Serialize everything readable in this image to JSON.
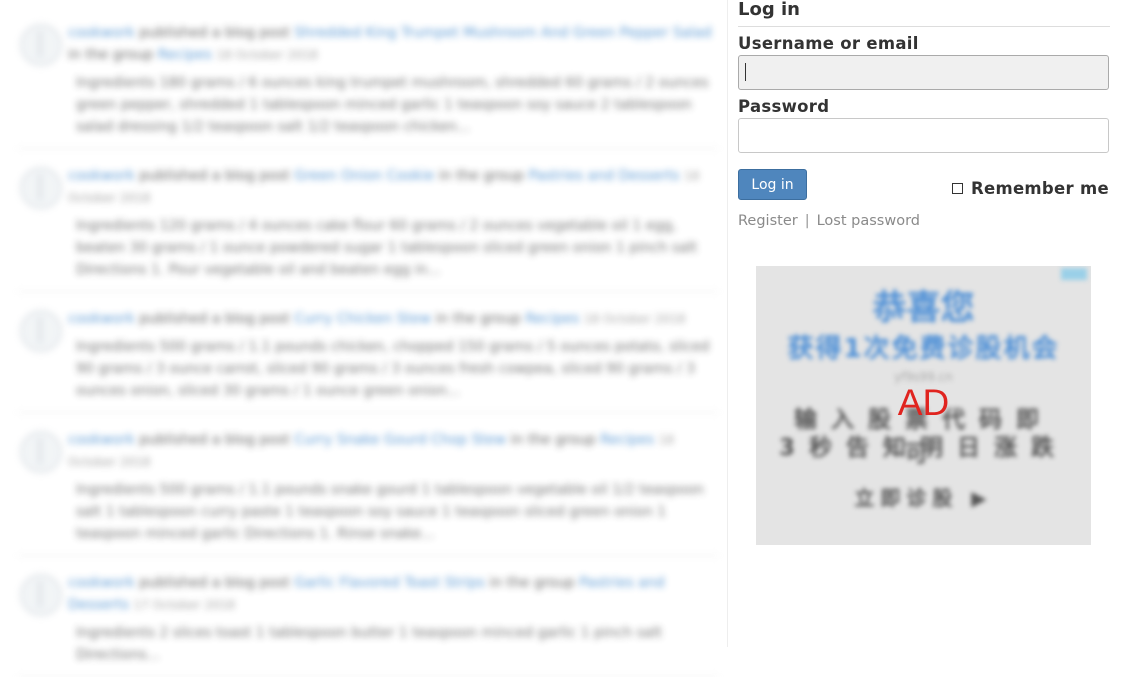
{
  "feed": {
    "posts": [
      {
        "author": "cookwork",
        "verb": "published a blog post",
        "title": "Shredded King Trumpet Mushroom And Green Pepper Salad",
        "in_group": "in the group",
        "group": "Recipes",
        "date": "18 October 2018",
        "excerpt": "Ingredients 180 grams / 6 ounces king trumpet mushroom, shredded 60 grams / 2 ounces green pepper, shredded 1 tablespoon minced garlic 1 teaspoon soy sauce 2 tablespoon salad dressing 1/2 teaspoon salt 1/2 teaspoon chicken..."
      },
      {
        "author": "cookwork",
        "verb": "published a blog post",
        "title": "Green Onion Cookie",
        "in_group": "in the group",
        "group": "Pastries and Desserts",
        "date": "18 October 2018",
        "excerpt": "Ingredients 120 grams / 4 ounces cake flour 60 grams / 2 ounces vegetable oil 1 egg, beaten 30 grams / 1 ounce powdered sugar 1 tablespoon sliced green onion 1 pinch salt Directions 1. Pour vegetable oil and beaten egg in..."
      },
      {
        "author": "cookwork",
        "verb": "published a blog post",
        "title": "Curry Chicken Stew",
        "in_group": "in the group",
        "group": "Recipes",
        "date": "18 October 2018",
        "excerpt": "Ingredients 500 grams / 1.1 pounds chicken, chopped 150 grams / 5 ounces potato, sliced 90 grams / 3 ounce carrot, sliced 90 grams / 3 ounces fresh cowpea, sliced 90 grams / 3 ounces onion, sliced 30 grams / 1 ounce green onion..."
      },
      {
        "author": "cookwork",
        "verb": "published a blog post",
        "title": "Curry Snake Gourd Chop Stew",
        "in_group": "in the group",
        "group": "Recipes",
        "date": "18 October 2018",
        "excerpt": "Ingredients 500 grams / 1.1 pounds snake gourd 1 tablespoon vegetable oil 1/2 teaspoon salt 1 tablespoon curry paste 1 teaspoon soy sauce 1 teaspoon sliced green onion 1 teaspoon minced garlic Directions 1. Rinse snake..."
      },
      {
        "author": "cookwork",
        "verb": "published a blog post",
        "title": "Garlic Flavored Toast Strips",
        "in_group": "in the group",
        "group": "Pastries and Desserts",
        "date": "17 October 2018",
        "excerpt": "Ingredients 2 slices toast 1 tablespoon butter 1 teaspoon minced garlic 1 pinch salt Directions..."
      }
    ]
  },
  "login": {
    "title": "Log in",
    "username_label": "Username or email",
    "username_value": "",
    "password_label": "Password",
    "password_value": "",
    "submit_label": "Log in",
    "remember_label": "Remember me",
    "remember_checked": false,
    "register_link": "Register",
    "separator": "|",
    "lost_password_link": "Lost password"
  },
  "ad": {
    "label": "AD",
    "headline": "恭喜您",
    "subheadline": "获得1次免费诊股机会",
    "url": "yf9s99.cn",
    "line1": "输入股票代码即可",
    "line2": "3秒告知明日涨跌",
    "cta": "立即诊股 ▶"
  },
  "colors": {
    "link": "#4a8fd0",
    "button": "#4f86bd",
    "ad_badge": "#e0241f"
  }
}
